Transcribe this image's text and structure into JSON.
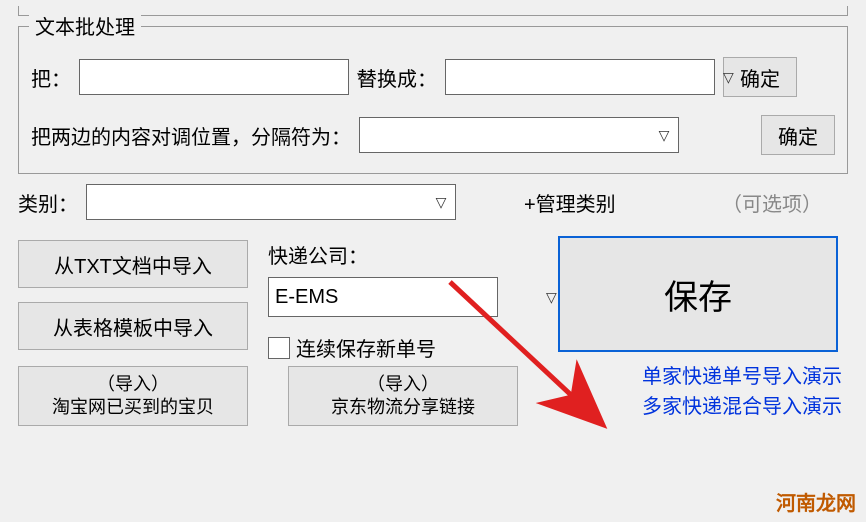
{
  "batch": {
    "legend": "文本批处理",
    "replace_from_label": "把：",
    "replace_to_label": "替换成：",
    "confirm_label": "确定",
    "swap_label": "把两边的内容对调位置，分隔符为："
  },
  "category": {
    "label": "类别：",
    "manage_label": "+管理类别",
    "optional_hint": "（可选项）"
  },
  "import": {
    "from_txt": "从TXT文档中导入",
    "from_template": "从表格模板中导入",
    "taobao_top": "（导入）",
    "taobao_bottom": "淘宝网已买到的宝贝",
    "jd_top": "（导入）",
    "jd_bottom": "京东物流分享链接"
  },
  "courier": {
    "label": "快递公司：",
    "value": "E-EMS",
    "checkbox_label": "连续保存新单号"
  },
  "save_button": "保存",
  "links": {
    "single": "单家快递单号导入演示",
    "multi": "多家快递混合导入演示"
  },
  "watermark": "河南龙网"
}
